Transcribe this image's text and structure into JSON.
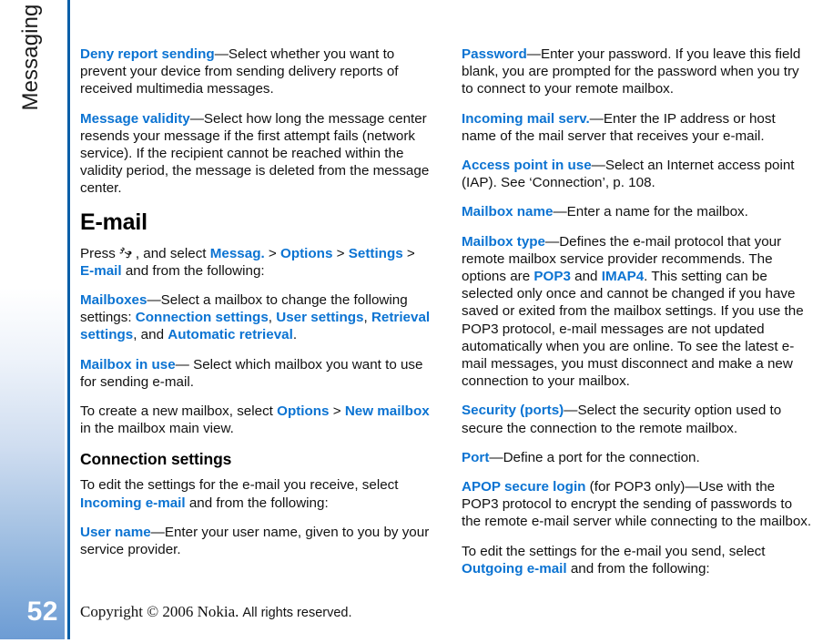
{
  "document": {
    "chapter_tab": "Messaging",
    "page_number": "52",
    "accent_link_color": "#0b73d2",
    "rule_color": "#0a5fa8",
    "sidebar_gradient_end": "#6d9cd4"
  },
  "footer": {
    "copyright_serif": "Copyright © 2006 Nokia.",
    "rights_sans": "All rights reserved."
  },
  "column_left": {
    "p_deny_report": {
      "term": "Deny report sending",
      "body": "—Select whether you want to prevent your device from sending delivery reports of received multimedia messages."
    },
    "p_message_validity": {
      "term": "Message validity",
      "body": "—Select how long the message center resends your message if the first attempt fails (network service). If the recipient cannot be reached within the validity period, the message is deleted from the message center."
    },
    "heading_email": "E-mail",
    "p_press": {
      "pre": "Press",
      "icon": "nokia-menu-key-icon",
      "after_icon": ", and select",
      "path_1": "Messag.",
      "sep_1": ">",
      "path_2": "Options",
      "sep_2": ">",
      "path_3": "Settings",
      "sep_3": ">",
      "path_4": "E-mail",
      "tail": "and from the following:"
    },
    "p_mailboxes": {
      "term": "Mailboxes",
      "body_1": "—Select a mailbox to change the following settings:",
      "opt_1": "Connection settings",
      "comma_1": ",",
      "opt_2": "User settings",
      "comma_2": ",",
      "opt_3": "Retrieval settings",
      "comma_3": ", and",
      "opt_4": "Automatic retrieval",
      "period": "."
    },
    "p_mailbox_in_use": {
      "term": "Mailbox in use",
      "body": "— Select which mailbox you want to use for sending e-mail."
    },
    "p_create_mailbox": {
      "pre": "To create a new mailbox, select",
      "path_1": "Options",
      "sep_1": ">",
      "path_2": "New mailbox",
      "tail": "in the mailbox main view."
    },
    "subheading_connection": "Connection settings",
    "p_edit_incoming": {
      "pre": "To edit the settings for the e-mail you receive, select",
      "term": "Incoming e-mail",
      "tail": "and from the following:"
    },
    "p_user_name": {
      "term": "User name",
      "body": "—Enter your user name, given to you by your service provider."
    }
  },
  "column_right": {
    "p_password": {
      "term": "Password",
      "body": "—Enter your password. If you leave this field blank, you are prompted for the password when you try to connect to your remote mailbox."
    },
    "p_incoming_mail_serv": {
      "term": "Incoming mail serv.",
      "body": "—Enter the IP address or host name of the mail server that receives your e-mail."
    },
    "p_access_point": {
      "term": "Access point in use",
      "body": "—Select an Internet access point (IAP). See ‘Connection’, p. 108."
    },
    "p_mailbox_name": {
      "term": "Mailbox name",
      "body": "—Enter a name for the mailbox."
    },
    "p_mailbox_type": {
      "term": "Mailbox type",
      "body_1": "—Defines the e-mail protocol that your remote mailbox service provider recommends. The options are",
      "opt_1": "POP3",
      "conj": "and",
      "opt_2": "IMAP4",
      "body_2": ". This setting can be selected only once and cannot be changed if you have saved or exited from the mailbox settings. If you use the POP3 protocol, e-mail messages are not updated automatically when you are online. To see the latest e-mail messages, you must disconnect and make a new connection to your mailbox."
    },
    "p_security_ports": {
      "term": "Security (ports)",
      "body": "—Select the security option used to secure the connection to the remote mailbox."
    },
    "p_port": {
      "term": "Port",
      "body": "—Define a port for the connection."
    },
    "p_apop": {
      "term": "APOP secure login",
      "body": " (for POP3 only)—Use with the POP3 protocol to encrypt the sending of passwords to the remote e-mail server while connecting to the mailbox."
    },
    "p_edit_outgoing": {
      "pre": "To edit the settings for the e-mail you send, select",
      "term": "Outgoing e-mail",
      "tail": "and from the following:"
    }
  }
}
